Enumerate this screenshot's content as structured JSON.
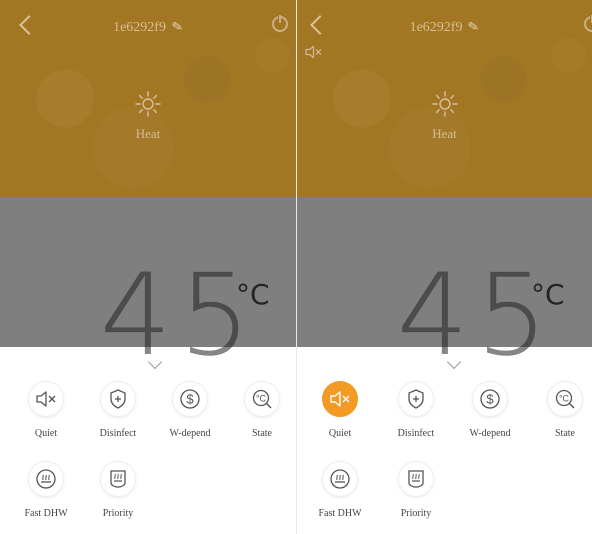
{
  "colors": {
    "mode_banner": "#a37624",
    "temperature_area": "#7f7f7f",
    "accent": "#f29a23",
    "sheet": "#ffffff"
  },
  "panels": [
    {
      "header": {
        "title": "1e6292f9",
        "back_icon": "chevron-left-icon",
        "edit_icon": "pencil-icon",
        "power_icon": "power-icon"
      },
      "mode": {
        "icon": "sun-icon",
        "label": "Heat"
      },
      "temperature": {
        "value": "45",
        "unit": "°C"
      },
      "features": [
        {
          "label": "Quiet",
          "icon": "speaker-mute-icon",
          "active": false
        },
        {
          "label": "Disinfect",
          "icon": "shield-plus-icon",
          "active": false
        },
        {
          "label": "W-depend",
          "icon": "dollar-icon",
          "active": false
        },
        {
          "label": "State",
          "icon": "temperature-search-icon",
          "active": false
        },
        {
          "label": "Fast DHW",
          "icon": "water-heater-icon",
          "active": false
        },
        {
          "label": "Priority",
          "icon": "hot-tank-icon",
          "active": false
        }
      ]
    },
    {
      "header": {
        "title": "1e6292f9",
        "back_icon": "chevron-left-icon",
        "edit_icon": "pencil-icon",
        "power_icon": "power-icon"
      },
      "mode": {
        "icon": "sun-icon",
        "label": "Heat"
      },
      "temperature": {
        "value": "45",
        "unit": "°C"
      },
      "features": [
        {
          "label": "Quiet",
          "icon": "speaker-mute-icon",
          "active": true
        },
        {
          "label": "Disinfect",
          "icon": "shield-plus-icon",
          "active": false
        },
        {
          "label": "W-depend",
          "icon": "dollar-icon",
          "active": false
        },
        {
          "label": "State",
          "icon": "temperature-search-icon",
          "active": false
        },
        {
          "label": "Fast DHW",
          "icon": "water-heater-icon",
          "active": false
        },
        {
          "label": "Priority",
          "icon": "hot-tank-icon",
          "active": false
        }
      ]
    }
  ]
}
